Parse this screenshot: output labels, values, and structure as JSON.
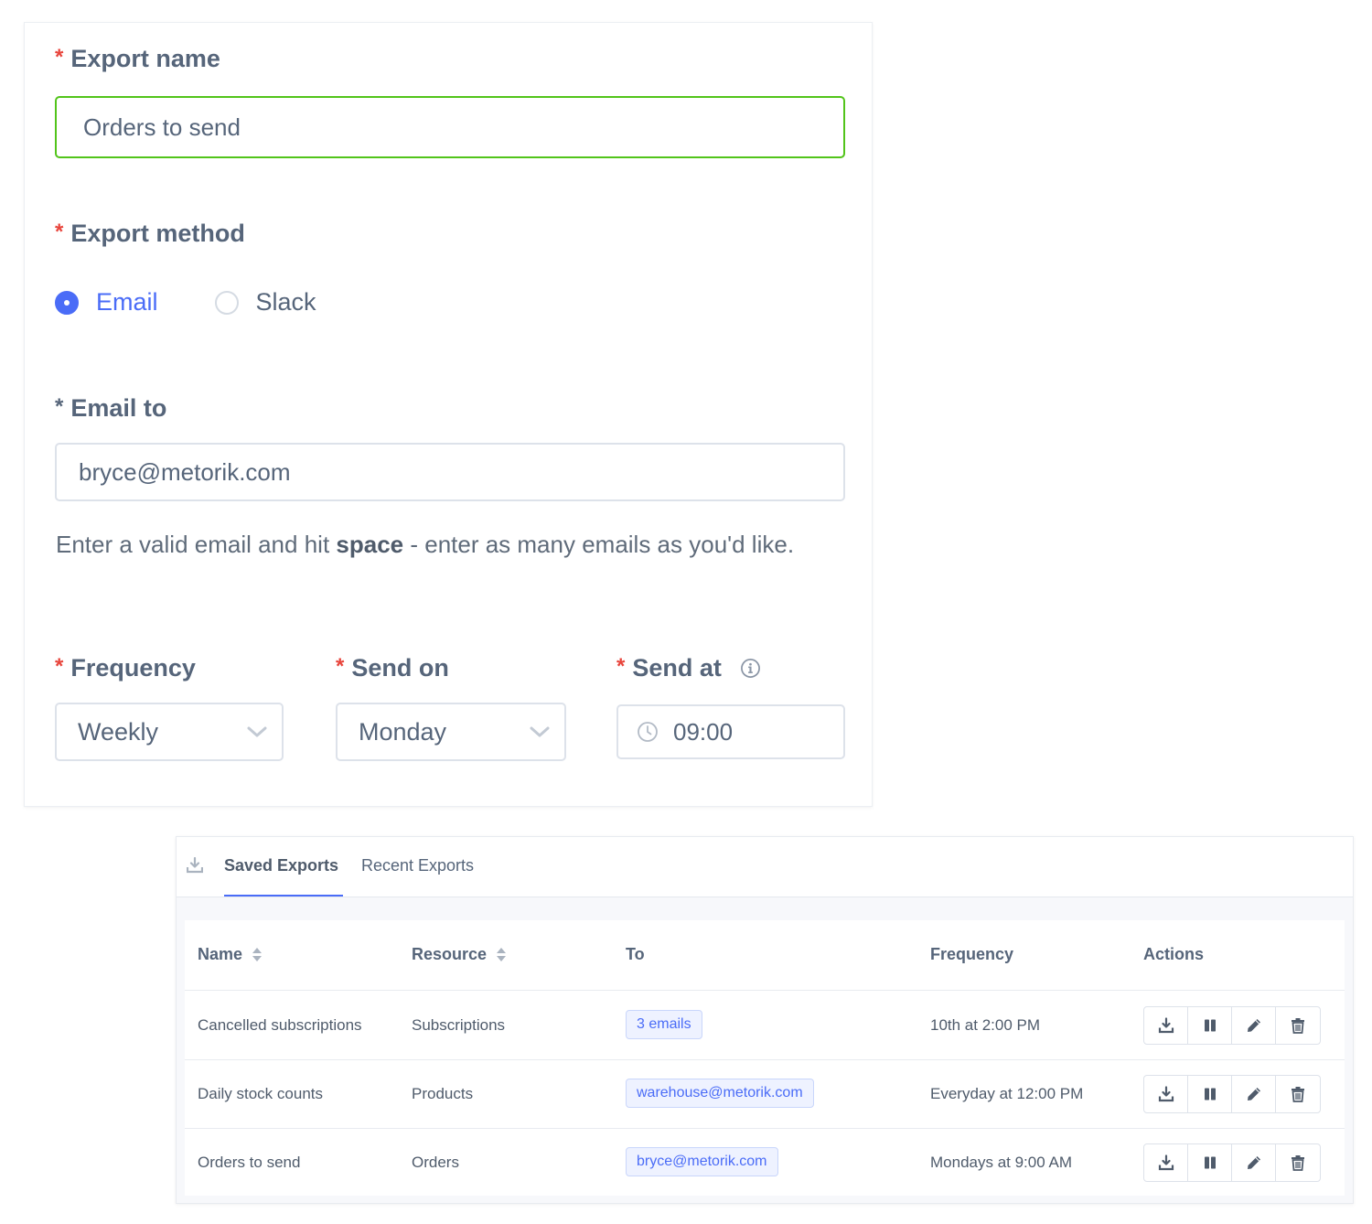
{
  "form": {
    "export_name": {
      "required": "*",
      "label": "Export name",
      "value": "Orders to send"
    },
    "export_method": {
      "required": "*",
      "label": "Export method",
      "options": [
        {
          "label": "Email",
          "checked": true
        },
        {
          "label": "Slack",
          "checked": false
        }
      ]
    },
    "email_to": {
      "required": "*",
      "label": "Email to",
      "value": "bryce@metorik.com",
      "help_prefix": "Enter a valid email and hit ",
      "help_bold": "space",
      "help_suffix": " - enter as many emails as you'd like."
    },
    "frequency": {
      "required": "*",
      "label": "Frequency",
      "value": "Weekly"
    },
    "send_on": {
      "required": "*",
      "label": "Send on",
      "value": "Monday"
    },
    "send_at": {
      "required": "*",
      "label": "Send at",
      "value": "09:00"
    }
  },
  "exports": {
    "tabs": [
      {
        "label": "Saved Exports",
        "active": true
      },
      {
        "label": "Recent Exports",
        "active": false
      }
    ],
    "columns": [
      "Name",
      "Resource",
      "To",
      "Frequency",
      "Actions"
    ],
    "rows": [
      {
        "name": "Cancelled subscriptions",
        "resource": "Subscriptions",
        "to": "3 emails",
        "frequency": "10th at 2:00 PM"
      },
      {
        "name": "Daily stock counts",
        "resource": "Products",
        "to": "warehouse@metorik.com",
        "frequency": "Everyday at 12:00 PM"
      },
      {
        "name": "Orders to send",
        "resource": "Orders",
        "to": "bryce@metorik.com",
        "frequency": "Mondays at 9:00 AM"
      }
    ]
  },
  "icons": {
    "download": "download-icon",
    "pause": "pause-icon",
    "edit": "pencil-icon",
    "delete": "trash-icon",
    "sort": "sort-icon",
    "clock": "clock-icon",
    "info": "info-icon",
    "chevron": "chevron-down-icon"
  },
  "colors": {
    "accent": "#4a6cf7",
    "required": "#e8453c",
    "valid_border": "#52c41a",
    "text": "#56657a"
  }
}
